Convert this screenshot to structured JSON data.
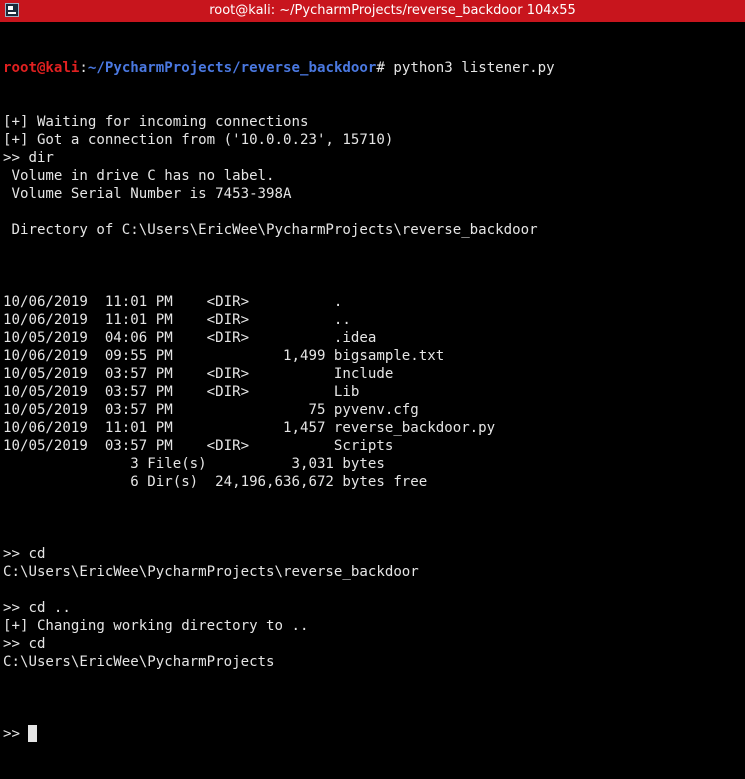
{
  "window": {
    "title": "root@kali: ~/PycharmProjects/reverse_backdoor 104x55",
    "icon": "terminal-icon",
    "title_bar_color": "#c8151d"
  },
  "prompt": {
    "user": "root@kali",
    "sep": ":",
    "path": "~/PycharmProjects/reverse_backdoor",
    "symbol": "# ",
    "command": "python3 listener.py",
    "user_color": "#e02020",
    "path_color": "#4a78e0"
  },
  "output_before_dir": [
    "[+] Waiting for incoming connections",
    "[+] Got a connection from ('10.0.0.23', 15710)",
    ">> dir",
    " Volume in drive C has no label.",
    " Volume Serial Number is 7453-398A",
    "",
    " Directory of C:\\Users\\EricWee\\PycharmProjects\\reverse_backdoor",
    ""
  ],
  "dir_listing": [
    "10/06/2019  11:01 PM    <DIR>          .",
    "10/06/2019  11:01 PM    <DIR>          ..",
    "10/05/2019  04:06 PM    <DIR>          .idea",
    "10/06/2019  09:55 PM             1,499 bigsample.txt",
    "10/05/2019  03:57 PM    <DIR>          Include",
    "10/05/2019  03:57 PM    <DIR>          Lib",
    "10/05/2019  03:57 PM                75 pyvenv.cfg",
    "10/06/2019  11:01 PM             1,457 reverse_backdoor.py",
    "10/05/2019  03:57 PM    <DIR>          Scripts",
    "               3 File(s)          3,031 bytes",
    "               6 Dir(s)  24,196,636,672 bytes free"
  ],
  "output_after_dir": [
    "",
    ">> cd",
    "C:\\Users\\EricWee\\PycharmProjects\\reverse_backdoor",
    "",
    ">> cd ..",
    "[+] Changing working directory to ..",
    ">> cd",
    "C:\\Users\\EricWee\\PycharmProjects",
    ""
  ],
  "input_prompt": ">> "
}
